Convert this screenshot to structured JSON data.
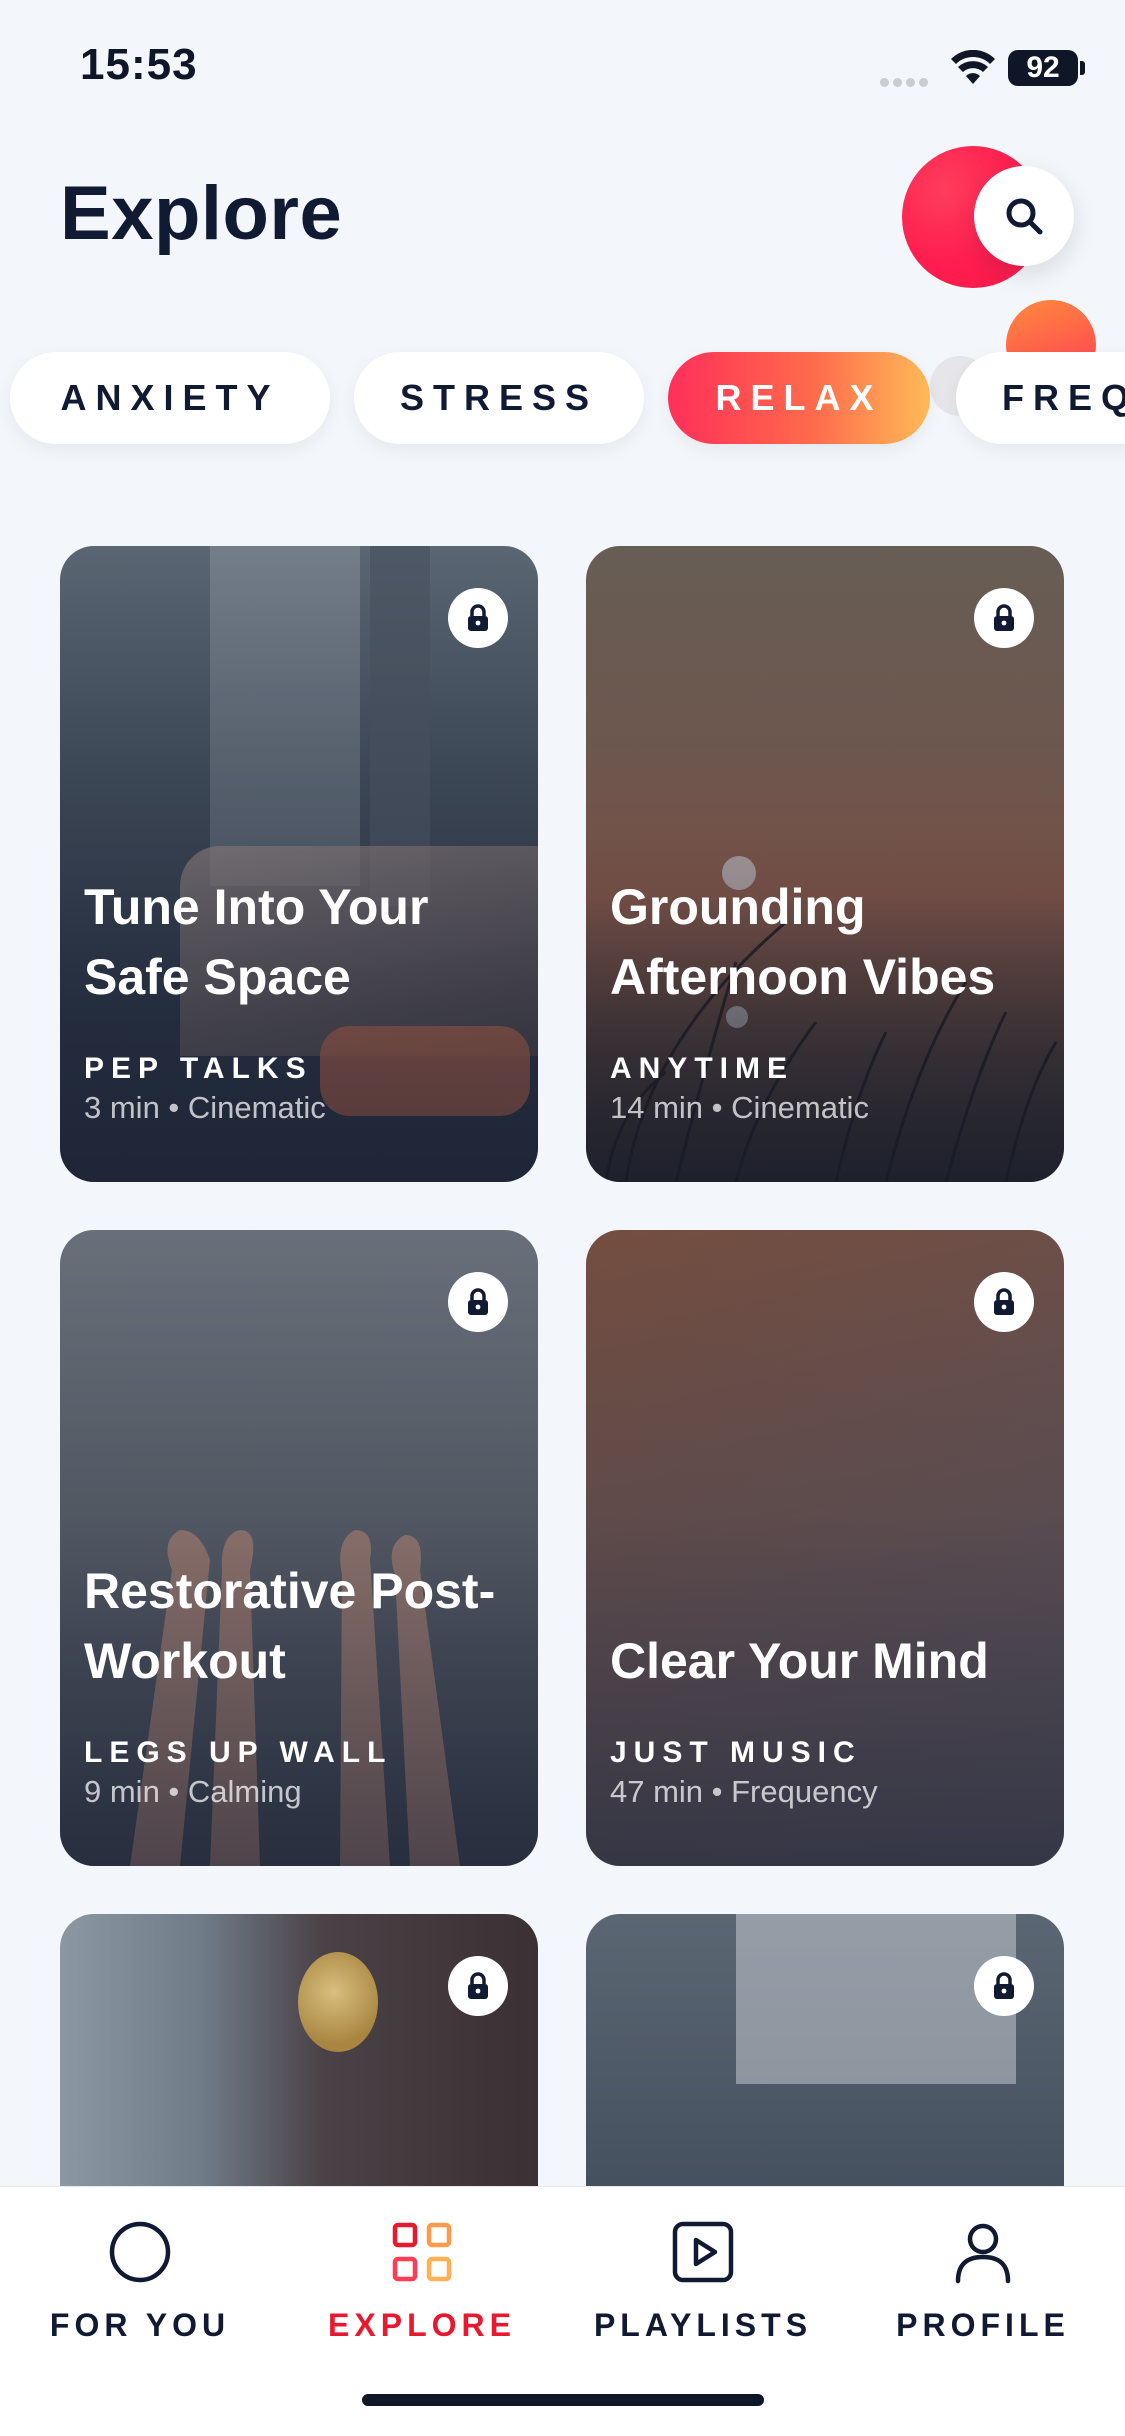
{
  "status_bar": {
    "time": "15:53",
    "battery": "92"
  },
  "header": {
    "title": "Explore"
  },
  "filters": [
    {
      "label": "ANXIETY",
      "active": false
    },
    {
      "label": "STRESS",
      "active": false
    },
    {
      "label": "RELAX",
      "active": true
    },
    {
      "label": "FREQ",
      "active": false
    }
  ],
  "cards": [
    {
      "title": "Tune Into Your Safe Space",
      "category": "PEP TALKS",
      "meta": "3 min • Cinematic",
      "locked": true
    },
    {
      "title": "Grounding Afternoon Vibes",
      "category": "ANYTIME",
      "meta": "14 min • Cinematic",
      "locked": true
    },
    {
      "title": "Restorative Post-Workout",
      "category": "LEGS UP WALL",
      "meta": "9 min • Calming",
      "locked": true
    },
    {
      "title": "Clear Your Mind",
      "category": "JUST MUSIC",
      "meta": "47 min • Frequency",
      "locked": true
    },
    {
      "title": "",
      "category": "",
      "meta": "",
      "locked": true
    },
    {
      "title": "",
      "category": "",
      "meta": "",
      "locked": true
    }
  ],
  "bottom_nav": [
    {
      "label": "FOR YOU",
      "icon": "circle-icon",
      "active": false
    },
    {
      "label": "EXPLORE",
      "icon": "grid-icon",
      "active": true
    },
    {
      "label": "PLAYLISTS",
      "icon": "play-square-icon",
      "active": false
    },
    {
      "label": "PROFILE",
      "icon": "user-icon",
      "active": false
    }
  ],
  "colors": {
    "accent": "#e8182f",
    "gradient_start": "#ff2f5a",
    "gradient_end": "#ffba58",
    "ink": "#101a33"
  }
}
